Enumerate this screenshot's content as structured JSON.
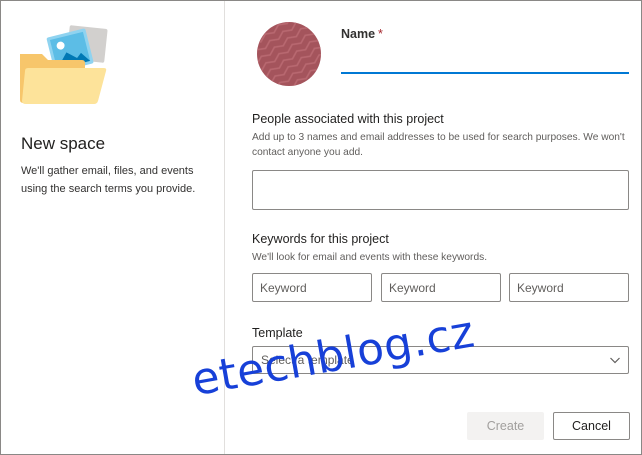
{
  "left": {
    "icon": "folder-with-image-icon",
    "title": "New space",
    "description": "We'll gather email, files, and events using the search terms you provide."
  },
  "form": {
    "avatar_icon": "project-avatar-icon",
    "name_label": "Name",
    "required_mark": "*",
    "name_value": "",
    "people": {
      "title": "People associated with this project",
      "help": "Add up to 3 names and email addresses to be used for search purposes. We won't contact anyone you add.",
      "value": ""
    },
    "keywords": {
      "title": "Keywords for this project",
      "help": "We'll look for email and events with these keywords.",
      "placeholders": [
        "Keyword",
        "Keyword",
        "Keyword"
      ]
    },
    "template": {
      "title": "Template",
      "placeholder": "Select a template",
      "icon": "chevron-down-icon"
    }
  },
  "watermark": "etechblog.cz",
  "buttons": {
    "create": "Create",
    "cancel": "Cancel"
  },
  "colors": {
    "accent": "#0078d4",
    "required": "#a4262c",
    "avatar": "#a4545c",
    "watermark": "#1740d8"
  }
}
